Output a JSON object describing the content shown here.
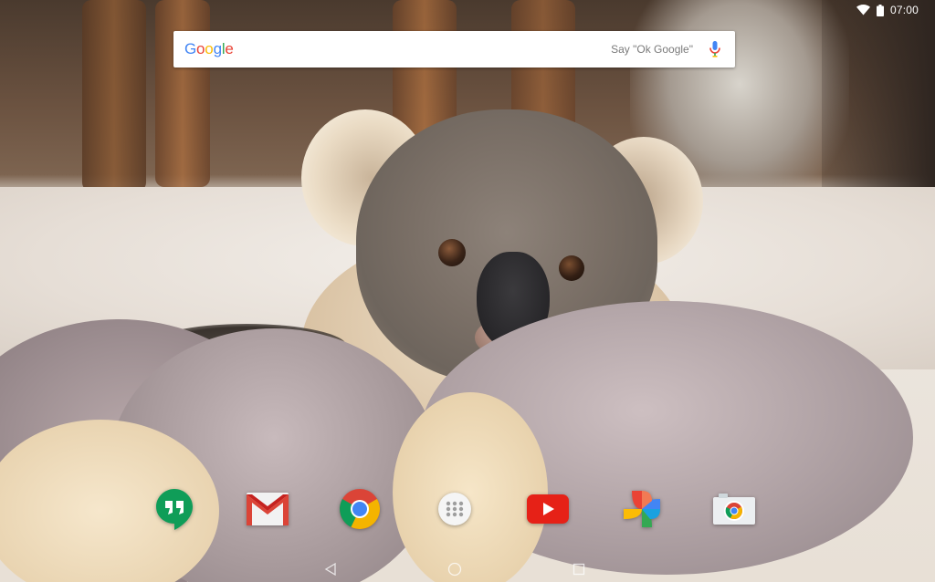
{
  "status_bar": {
    "time": "07:00",
    "icons": [
      "wifi-icon",
      "battery-icon"
    ]
  },
  "search_bar": {
    "logo_letters": [
      {
        "char": "G",
        "color": "#4285F4"
      },
      {
        "char": "o",
        "color": "#EA4335"
      },
      {
        "char": "o",
        "color": "#FBBC05"
      },
      {
        "char": "g",
        "color": "#4285F4"
      },
      {
        "char": "l",
        "color": "#34A853"
      },
      {
        "char": "e",
        "color": "#EA4335"
      }
    ],
    "hint": "Say \"Ok Google\"",
    "mic_icon": "mic-icon"
  },
  "dock": {
    "apps": [
      {
        "icon": "hangouts-icon"
      },
      {
        "icon": "gmail-icon"
      },
      {
        "icon": "chrome-icon"
      },
      {
        "icon": "app-drawer-icon"
      },
      {
        "icon": "youtube-icon"
      },
      {
        "icon": "photos-icon"
      },
      {
        "icon": "camera-icon"
      }
    ]
  },
  "nav_bar": {
    "buttons": [
      "back-icon",
      "home-icon",
      "recents-icon"
    ]
  }
}
